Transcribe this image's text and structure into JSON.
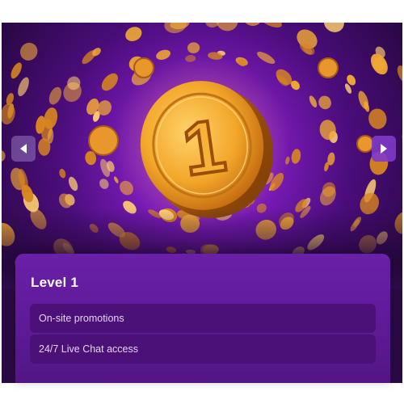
{
  "hero": {
    "image": "gold-coin-swirl-level-1",
    "coin_number": "1",
    "prev_icon": "chevron-left-icon",
    "next_icon": "chevron-right-icon"
  },
  "level_card": {
    "title": "Level 1",
    "benefits": [
      {
        "label": "On-site promotions"
      },
      {
        "label": "24/7 Live Chat access"
      }
    ]
  },
  "colors": {
    "card_background": "#5c1a95",
    "row_background": "#4b1178",
    "coin_gold": "#f3a629",
    "next_button": "#7e3ac8"
  }
}
